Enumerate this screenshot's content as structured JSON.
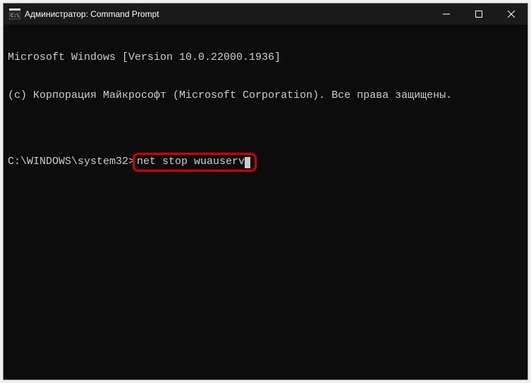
{
  "titlebar": {
    "title": "Администратор: Command Prompt"
  },
  "terminal": {
    "line1": "Microsoft Windows [Version 10.0.22000.1936]",
    "line2": "(c) Корпорация Майкрософт (Microsoft Corporation). Все права защищены.",
    "blank": "",
    "prompt": "C:\\WINDOWS\\system32>",
    "command": "net stop wuauserv"
  },
  "highlight": {
    "color": "#d40000"
  }
}
